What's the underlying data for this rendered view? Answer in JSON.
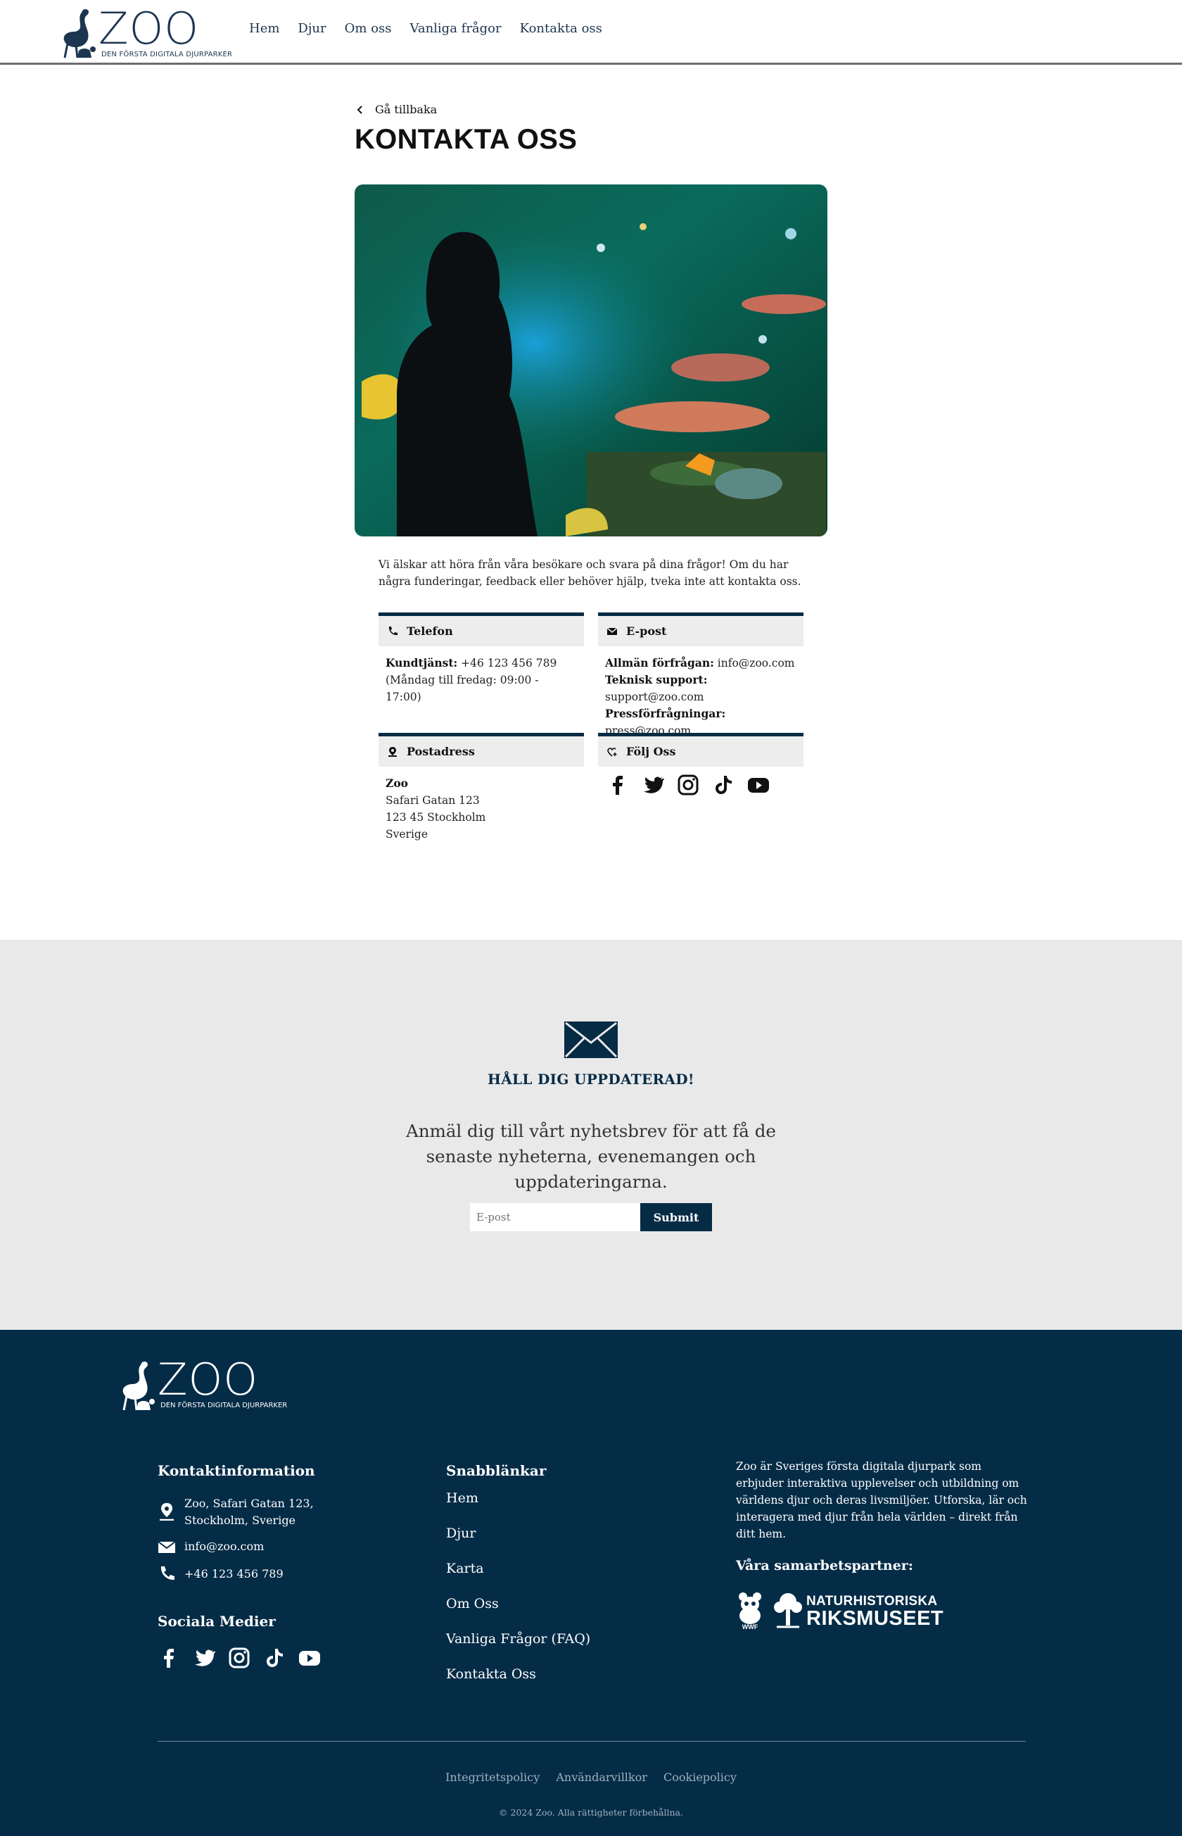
{
  "header": {
    "logo_text": "ZOO",
    "logo_tagline": "DEN FÖRSTA DIGITALA DJURPARKER",
    "nav": [
      "Hem",
      "Djur",
      "Om oss",
      "Vanliga frågor",
      "Kontakta oss"
    ]
  },
  "main": {
    "back_label": "Gå tillbaka",
    "title": "KONTAKTA OSS",
    "intro": "Vi älskar att höra från våra besökare och svara på dina frågor! Om du har några funderingar, feedback eller behöver hjälp, tveka inte att kontakta oss.",
    "phone": {
      "heading": "Telefon",
      "label": "Kundtjänst:",
      "value": " +46 123 456 789",
      "hours": "(Måndag till fredag: 09:00 - 17:00)"
    },
    "email": {
      "heading": "E-post",
      "rows": [
        {
          "label": "Allmän förfrågan:",
          "value": " info@zoo.com"
        },
        {
          "label": "Teknisk support:",
          "value": " support@zoo.com"
        },
        {
          "label": "Pressförfrågningar:",
          "value": " press@zoo.com"
        }
      ]
    },
    "address": {
      "heading": "Postadress",
      "name": "Zoo",
      "street": "Safari Gatan 123",
      "city": "123 45 Stockholm",
      "country": "Sverige"
    },
    "follow": {
      "heading": "Följ Oss",
      "icons": [
        "facebook-icon",
        "twitter-icon",
        "instagram-icon",
        "tiktok-icon",
        "youtube-icon"
      ]
    }
  },
  "newsletter": {
    "title": "HÅLL DIG UPPDATERAD!",
    "text": "Anmäl dig till vårt nyhetsbrev för att få de senaste nyheterna, evenemangen och uppdateringarna.",
    "placeholder": "E-post",
    "button": "Submit"
  },
  "footer": {
    "logo_text": "ZOO",
    "logo_tagline": "DEN FÖRSTA DIGITALA DJURPARKER",
    "contact_title": "Kontaktinformation",
    "contact_address_1": "Zoo, Safari Gatan 123,",
    "contact_address_2": "Stockholm, Sverige",
    "contact_email": "info@zoo.com",
    "contact_phone": "+46 123 456 789",
    "social_title": "Sociala Medier",
    "quicklinks_title": "Snabblänkar",
    "quicklinks": [
      "Hem",
      "Djur",
      "Karta",
      "Om Oss",
      "Vanliga Frågor (FAQ)",
      "Kontakta Oss"
    ],
    "about": "Zoo är Sveriges första digitala djurpark som erbjuder interaktiva upplevelser och utbildning om världens djur och deras livsmiljöer. Utforska, lär och interagera med djur från hela världen – direkt från ditt hem.",
    "partners_title": "Våra samarbetspartner:",
    "partner_1": "WWF",
    "partner_2_line1": "NATURHISTORISKA",
    "partner_2_line2": "RIKSMUSEET",
    "legal": [
      "Integritetspolicy",
      "Användarvillkor",
      "Cookiepolicy"
    ],
    "copyright": "© 2024 Zoo. Alla rättigheter förbehållna."
  },
  "colors": {
    "brand_navy": "#062b45",
    "footer_bg": "#052c47",
    "newsletter_bg": "#e9e9e9",
    "card_head_bg": "#ededed"
  }
}
